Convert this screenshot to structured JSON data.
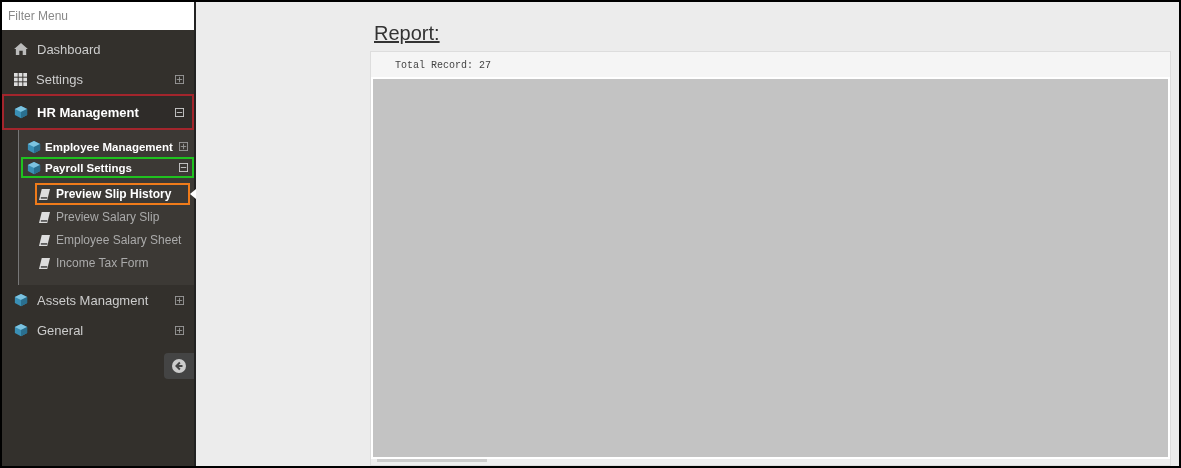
{
  "sidebar": {
    "filter": {
      "placeholder": "Filter Menu"
    },
    "items": [
      {
        "label": "Dashboard",
        "kind": "top"
      },
      {
        "label": "Settings",
        "kind": "top",
        "expanded": false
      },
      {
        "label": "HR Management",
        "kind": "top",
        "expanded": true,
        "color": "#a3252c",
        "children": [
          {
            "label": "Employee Management",
            "kind": "sub",
            "expanded": false
          },
          {
            "label": "Payroll Settings",
            "kind": "sub",
            "expanded": true,
            "color": "#1fc21f",
            "children": [
              {
                "label": "Preview Slip History",
                "kind": "leaf",
                "selected": true,
                "color": "#f07b1a"
              },
              {
                "label": "Preview Salary Slip",
                "kind": "leaf",
                "selected": false
              },
              {
                "label": "Employee Salary Sheet",
                "kind": "leaf",
                "selected": false
              },
              {
                "label": "Income Tax Form",
                "kind": "leaf",
                "selected": false
              }
            ]
          }
        ]
      },
      {
        "label": "Assets Managment",
        "kind": "top",
        "expanded": false
      },
      {
        "label": "General",
        "kind": "top",
        "expanded": false
      }
    ]
  },
  "report": {
    "title": "Report:",
    "total_record": "Total Record: 27"
  }
}
